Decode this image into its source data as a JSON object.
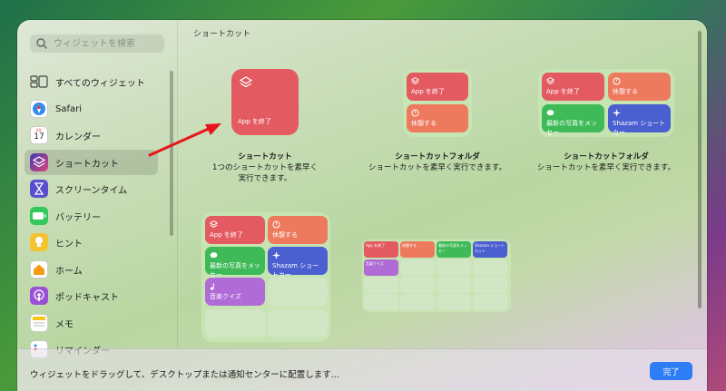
{
  "search": {
    "placeholder": "ウィジェットを検索"
  },
  "sidebar": {
    "items": [
      {
        "label": "すべてのウィジェット",
        "icon": "grid-icon"
      },
      {
        "label": "Safari",
        "icon": "safari-compass-icon"
      },
      {
        "label": "カレンダー",
        "icon": "calendar-icon",
        "calendar_month": "JUL",
        "calendar_day": "17"
      },
      {
        "label": "ショートカット",
        "icon": "shortcuts-icon",
        "selected": true
      },
      {
        "label": "スクリーンタイム",
        "icon": "hourglass-icon"
      },
      {
        "label": "バッテリー",
        "icon": "battery-icon"
      },
      {
        "label": "ヒント",
        "icon": "lightbulb-icon"
      },
      {
        "label": "ホーム",
        "icon": "home-icon"
      },
      {
        "label": "ポッドキャスト",
        "icon": "podcasts-icon"
      },
      {
        "label": "メモ",
        "icon": "notes-icon"
      },
      {
        "label": "リマインダー",
        "icon": "reminders-icon"
      }
    ]
  },
  "main": {
    "section_title": "ショートカット",
    "widgets": [
      {
        "title": "ショートカット",
        "description": "1つのショートカットを素早く実行できます。",
        "tiles": [
          {
            "label": "App を終了",
            "color": "#e35a60"
          }
        ]
      },
      {
        "title": "ショートカットフォルダ",
        "description": "ショートカットを素早く実行できます。",
        "tiles": [
          {
            "label": "App を終了",
            "color": "#e35a60"
          },
          {
            "label": "休憩する",
            "color": "#ee7a5e"
          }
        ]
      },
      {
        "title": "ショートカットフォルダ",
        "description": "ショートカットを素早く実行できます。",
        "tiles": [
          {
            "label": "App を終了",
            "color": "#e35a60"
          },
          {
            "label": "休憩する",
            "color": "#ee7a5e"
          },
          {
            "label": "最新の写真をメッセー",
            "color": "#3fba58"
          },
          {
            "label": "Shazam ショートカー",
            "color": "#4a5fd0"
          }
        ]
      },
      {
        "tiles": [
          {
            "label": "App を終了",
            "color": "#e35a60"
          },
          {
            "label": "休憩する",
            "color": "#ee7a5e"
          },
          {
            "label": "最新の写真をメッセー",
            "color": "#3fba58"
          },
          {
            "label": "Shazam ショートカー",
            "color": "#4a5fd0"
          },
          {
            "label": "音楽クイズ",
            "color": "#b06bd6"
          }
        ]
      },
      {
        "tiles": [
          {
            "label": "App を終了",
            "color": "#e35a60"
          },
          {
            "label": "休憩する",
            "color": "#ee7a5e"
          },
          {
            "label": "最新の写真をメッセー",
            "color": "#3fba58"
          },
          {
            "label": "Shazam ショートカット",
            "color": "#4a5fd0"
          },
          {
            "label": "音楽クイズ",
            "color": "#b06bd6"
          }
        ]
      }
    ]
  },
  "footer": {
    "hint": "ウィジェットをドラッグして、デスクトップまたは通知センターに配置します...",
    "done_label": "完了"
  },
  "annotation": {
    "arrow_color": "#e8141a"
  }
}
